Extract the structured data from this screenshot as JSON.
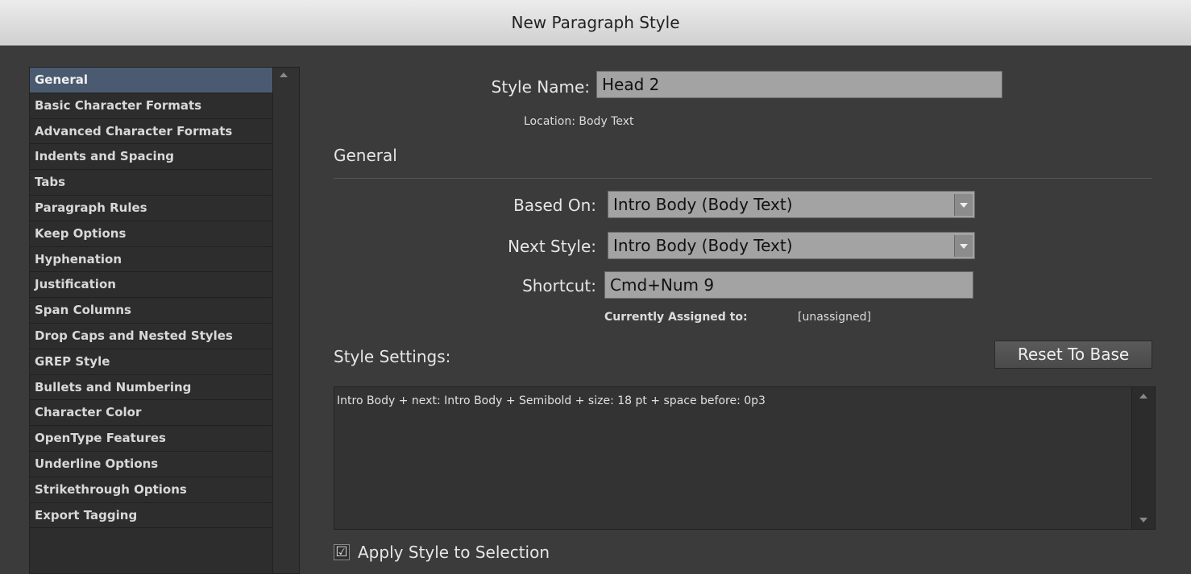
{
  "window": {
    "title": "New Paragraph Style"
  },
  "sidebar": {
    "items": [
      {
        "label": "General",
        "selected": true
      },
      {
        "label": "Basic Character Formats"
      },
      {
        "label": "Advanced Character Formats"
      },
      {
        "label": "Indents and Spacing"
      },
      {
        "label": "Tabs"
      },
      {
        "label": "Paragraph Rules"
      },
      {
        "label": "Keep Options"
      },
      {
        "label": "Hyphenation"
      },
      {
        "label": "Justification"
      },
      {
        "label": "Span Columns"
      },
      {
        "label": "Drop Caps and Nested Styles"
      },
      {
        "label": "GREP Style"
      },
      {
        "label": "Bullets and Numbering"
      },
      {
        "label": "Character Color"
      },
      {
        "label": "OpenType Features"
      },
      {
        "label": "Underline Options"
      },
      {
        "label": "Strikethrough Options"
      },
      {
        "label": "Export Tagging"
      }
    ]
  },
  "form": {
    "style_name_label": "Style Name:",
    "style_name_value": "Head 2",
    "location_label": "Location:",
    "location_value": "Body Text",
    "section_general": "General",
    "based_on_label": "Based On:",
    "based_on_value": "Intro Body (Body Text)",
    "next_style_label": "Next Style:",
    "next_style_value": "Intro Body (Body Text)",
    "shortcut_label": "Shortcut:",
    "shortcut_value": "Cmd+Num 9",
    "assigned_label": "Currently Assigned to:",
    "assigned_value": "[unassigned]",
    "style_settings_label": "Style Settings:",
    "reset_button": "Reset To Base",
    "style_settings_text": "Intro Body + next: Intro Body + Semibold + size: 18 pt + space before: 0p3",
    "apply_label": "Apply Style to Selection",
    "apply_checked": true,
    "check_glyph": "☑"
  },
  "colors": {
    "background": "#3b3b3b",
    "selection": "#4a5a70",
    "field": "#a3a3a3"
  }
}
